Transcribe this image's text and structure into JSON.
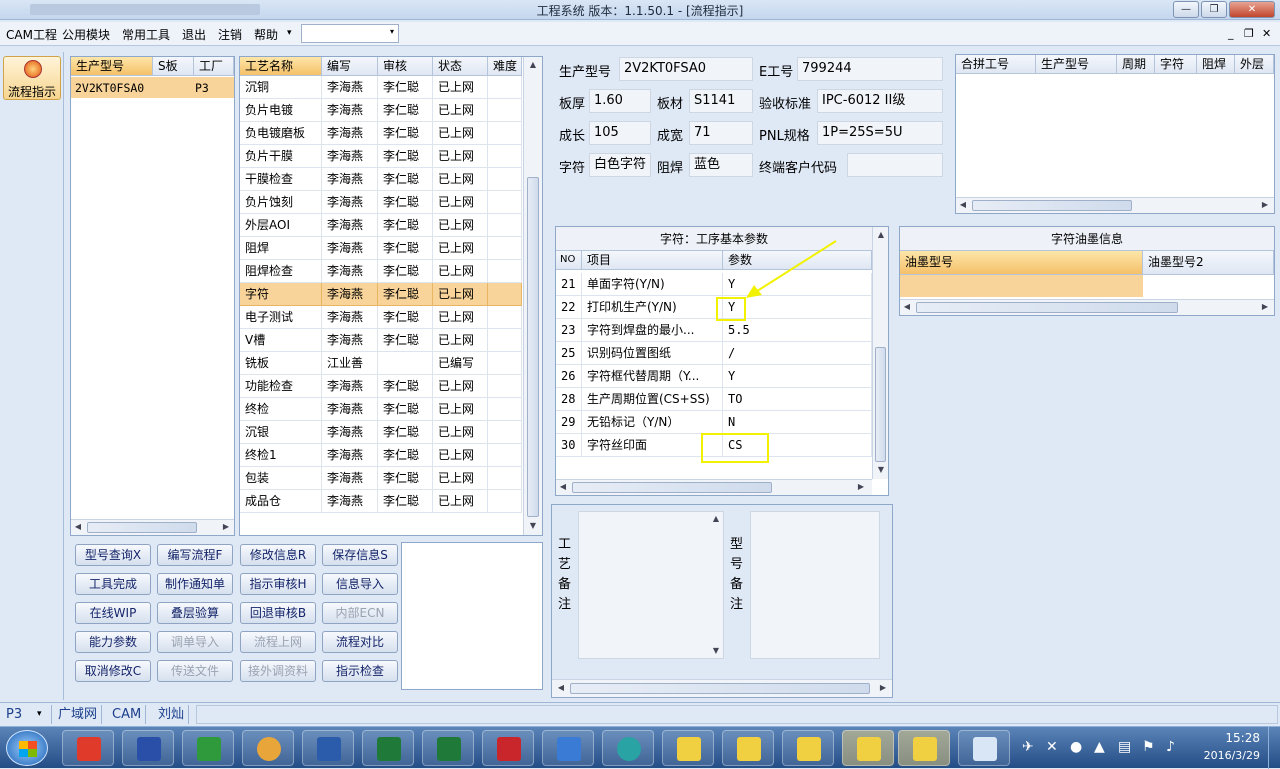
{
  "window": {
    "title": "工程系统  版本：1.1.50.1 - [流程指示]",
    "minimize": "—",
    "restore": "❐",
    "close": "✕"
  },
  "menu": {
    "items": [
      "CAM工程",
      "公用模块",
      "常用工具",
      "退出",
      "注销",
      "帮助"
    ],
    "help_arrow": "▾",
    "combo_arrow": "▾",
    "mdi": [
      "_",
      "❐",
      "✕"
    ]
  },
  "nav": {
    "label": "流程指示"
  },
  "model_list": {
    "headers": [
      "生产型号",
      "S板",
      "工厂"
    ],
    "rows": [
      [
        "2V2KT0FSA0",
        "",
        "P3"
      ]
    ]
  },
  "process_table": {
    "headers": [
      "工艺名称",
      "编写",
      "审核",
      "状态",
      "难度"
    ],
    "selected_index": 9,
    "rows": [
      [
        "沉铜",
        "李海燕",
        "李仁聪",
        "已上网"
      ],
      [
        "负片电镀",
        "李海燕",
        "李仁聪",
        "已上网"
      ],
      [
        "负电镀磨板",
        "李海燕",
        "李仁聪",
        "已上网"
      ],
      [
        "负片干膜",
        "李海燕",
        "李仁聪",
        "已上网"
      ],
      [
        "干膜检查",
        "李海燕",
        "李仁聪",
        "已上网"
      ],
      [
        "负片蚀刻",
        "李海燕",
        "李仁聪",
        "已上网"
      ],
      [
        "外层AOI",
        "李海燕",
        "李仁聪",
        "已上网"
      ],
      [
        "阻焊",
        "李海燕",
        "李仁聪",
        "已上网"
      ],
      [
        "阻焊检查",
        "李海燕",
        "李仁聪",
        "已上网"
      ],
      [
        "字符",
        "李海燕",
        "李仁聪",
        "已上网"
      ],
      [
        "电子测试",
        "李海燕",
        "李仁聪",
        "已上网"
      ],
      [
        "V槽",
        "李海燕",
        "李仁聪",
        "已上网"
      ],
      [
        "铣板",
        "江业善",
        "",
        "已编写"
      ],
      [
        "功能检查",
        "李海燕",
        "李仁聪",
        "已上网"
      ],
      [
        "终检",
        "李海燕",
        "李仁聪",
        "已上网"
      ],
      [
        "沉银",
        "李海燕",
        "李仁聪",
        "已上网"
      ],
      [
        "终检1",
        "李海燕",
        "李仁聪",
        "已上网"
      ],
      [
        "包装",
        "李海燕",
        "李仁聪",
        "已上网"
      ],
      [
        "成品仓",
        "李海燕",
        "李仁聪",
        "已上网"
      ]
    ]
  },
  "actions": [
    {
      "label": "型号查询X",
      "enabled": true
    },
    {
      "label": "编写流程F",
      "enabled": true
    },
    {
      "label": "修改信息R",
      "enabled": true
    },
    {
      "label": "保存信息S",
      "enabled": true
    },
    {
      "label": "工具完成",
      "enabled": true
    },
    {
      "label": "制作通知单",
      "enabled": true
    },
    {
      "label": "指示审核H",
      "enabled": true
    },
    {
      "label": "信息导入",
      "enabled": true
    },
    {
      "label": "在线WIP",
      "enabled": true
    },
    {
      "label": "叠层验算",
      "enabled": true
    },
    {
      "label": "回退审核B",
      "enabled": true
    },
    {
      "label": "内部ECN",
      "enabled": false
    },
    {
      "label": "能力参数",
      "enabled": true
    },
    {
      "label": "调单导入",
      "enabled": false
    },
    {
      "label": "流程上网",
      "enabled": false
    },
    {
      "label": "流程对比",
      "enabled": true
    },
    {
      "label": "取消修改C",
      "enabled": true
    },
    {
      "label": "传送文件",
      "enabled": false
    },
    {
      "label": "接外调资料",
      "enabled": false
    },
    {
      "label": "指示检查",
      "enabled": true
    }
  ],
  "info": {
    "model_label": "生产型号",
    "model": "2V2KT0FSA0",
    "eno_label": "E工号",
    "eno": "799244",
    "thickness_label": "板厚",
    "thickness": "1.60",
    "material_label": "板材",
    "material": "S1141",
    "standard_label": "验收标准",
    "standard": "IPC-6012 II级",
    "length_label": "成长",
    "length": "105",
    "width_label": "成宽",
    "width": "71",
    "pnl_label": "PNL规格",
    "pnl": "1P=25S=5U",
    "char_label": "字符",
    "char": "白色字符",
    "mask_label": "阻焊",
    "mask": "蓝色",
    "customer_label": "终端客户代码",
    "customer": ""
  },
  "merge_table": {
    "headers": [
      "合拼工号",
      "生产型号",
      "周期",
      "字符",
      "阻焊",
      "外层"
    ]
  },
  "params": {
    "title": "字符：工序基本参数",
    "headers": [
      "NO",
      "项目",
      "参数"
    ],
    "rows": [
      [
        "21",
        "单面字符(Y/N)",
        "Y"
      ],
      [
        "22",
        "打印机生产(Y/N)",
        "Y"
      ],
      [
        "23",
        "字符到焊盘的最小...",
        "5.5"
      ],
      [
        "25",
        "识别码位置图纸",
        "/"
      ],
      [
        "26",
        "字符框代替周期（Y...",
        "Y"
      ],
      [
        "28",
        "生产周期位置(CS+SS)",
        "TO"
      ],
      [
        "29",
        "无铅标记（Y/N）",
        "N"
      ],
      [
        "30",
        "字符丝印面",
        "CS"
      ]
    ]
  },
  "ink": {
    "title": "字符油墨信息",
    "headers": [
      "油墨型号",
      "油墨型号2"
    ]
  },
  "remarks": {
    "process_label": "工艺备注",
    "model_label": "型号备注"
  },
  "status": {
    "factory": "P3",
    "dropdown": "▾",
    "items": [
      "广域网",
      "CAM",
      "刘灿"
    ]
  },
  "tray": {
    "time": "15:28",
    "date": "2016/3/29"
  },
  "colors": {
    "highlight_row": "#f8d49a",
    "annotation": "#f2f200"
  }
}
